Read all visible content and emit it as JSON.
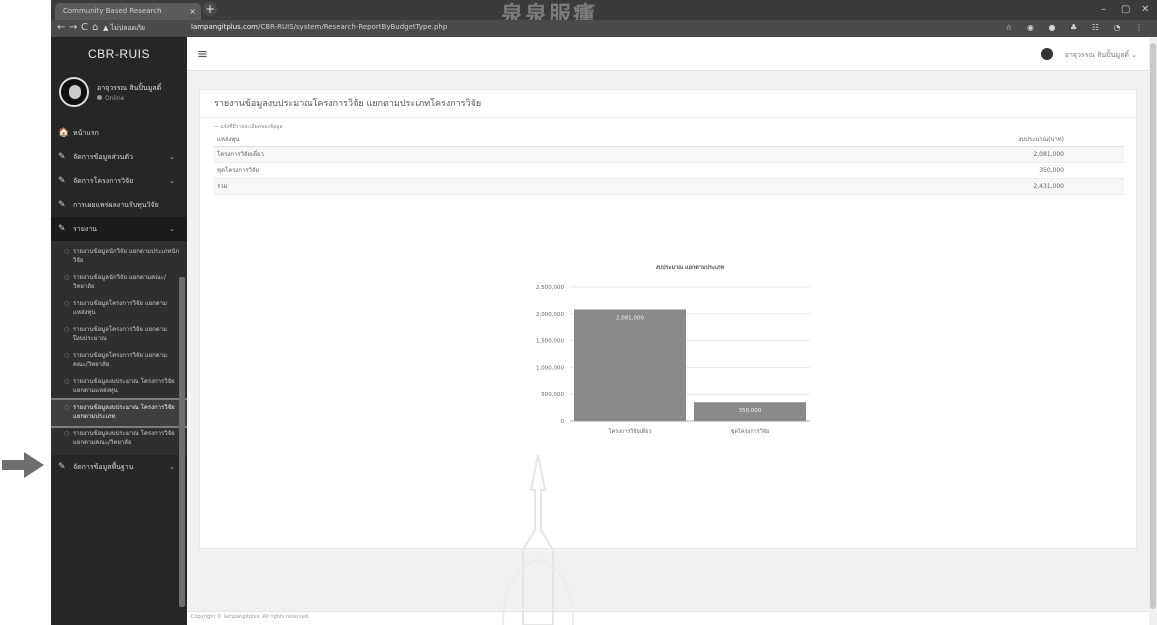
{
  "browser": {
    "tab_title": "Community Based Research",
    "tab_close": "×",
    "new_tab": "+",
    "header_watermark": "泉泉服瘇",
    "window_controls": {
      "minimize": "–",
      "maximize": "▢",
      "close": "✕"
    },
    "nav": {
      "back": "←",
      "forward": "→",
      "reload": "C",
      "home": "⌂"
    },
    "security_label": "▲ ไม่ปลอดภัย",
    "url_host": "lampangitplus.com",
    "url_path": "/CBR-RUIS/system/Research-ReportByBudgetType.php",
    "extension_icons": "☆ ◉ ● ♣ ☷ ◔ ⋮"
  },
  "sidebar": {
    "brand": "CBR-RUIS",
    "user": {
      "name": "อาจุวรรณ สินปิ้นมูลดิ์",
      "status": "Online"
    },
    "menu": [
      {
        "label": "หน้าแรก",
        "icon": "home-icon",
        "glyph": "🏠",
        "chevron": ""
      },
      {
        "label": "จัดการข้อมูลส่วนตัว",
        "icon": "edit-icon",
        "glyph": "✎",
        "chevron": "⌄"
      },
      {
        "label": "จัดการโครงการวิจัย",
        "icon": "edit-icon",
        "glyph": "✎",
        "chevron": "⌄"
      },
      {
        "label": "การเผยแพร่ผลงานรับทุนวิจัย",
        "icon": "edit-icon",
        "glyph": "✎",
        "chevron": ""
      },
      {
        "label": "รายงาน",
        "icon": "edit-icon",
        "glyph": "✎",
        "chevron": "⌄"
      }
    ],
    "report_submenu": [
      "รายงานข้อมูลนักวิจัย แยกตามประเภทนักวิจัย",
      "รายงานข้อมูลนักวิจัย แยกตามคณะ/วิทยาลัย",
      "รายงานข้อมูลโครงการวิจัย แยกตามแหล่งทุน",
      "รายงานข้อมูลโครงการวิจัย แยกตามปีงบประมาณ",
      "รายงานข้อมูลโครงการวิจัย แยกตามคณะ/วิทยาลัย",
      "รายงานข้อมูลงบประมาณ โครงการวิจัย แยกตามแหล่งทุน",
      "รายงานข้อมูลงบประมาณ โครงการวิจัย แยกตามประเภท",
      "รายงานข้อมูลงบประมาณ โครงการวิจัย แยกตามคณะ/วิทยาลัย"
    ],
    "last_menu": {
      "label": "จัดการข้อมูลพื้นฐาน",
      "glyph": "✎",
      "chevron": "⌄"
    },
    "bullet": "○"
  },
  "topbar": {
    "hamburger": "≡",
    "user_name": "อาจุวรรณ สินปิ้นมูลดิ์ ⌄"
  },
  "report": {
    "title": "รายงานข้อมูลงบประมาณโครงการวิจัย แยกตามประเภทโครงการวิจัย",
    "subnote": "— แจ้งที่มีรายละเอียดของข้อมูล",
    "table": {
      "headers": [
        "แหล่งทุน",
        "งบประมาณ(บาท)"
      ],
      "rows": [
        [
          "โครงการวิจัยเดี่ยว",
          "2,081,000"
        ],
        [
          "ชุดโครงการวิจัย",
          "350,000"
        ],
        [
          "รวม",
          "2,431,000"
        ]
      ]
    }
  },
  "chart_data": {
    "type": "bar",
    "title": "งบประมาณ แยกตามประเภท",
    "categories": [
      "โครงการวิจัยเดี่ยว",
      "ชุดโครงการวิจัย"
    ],
    "values": [
      2081000,
      350000
    ],
    "data_labels": [
      "2,081,000",
      "350,000"
    ],
    "yticks": [
      "0",
      "500,000",
      "1,000,000",
      "1,500,000",
      "2,000,000",
      "2,500,000"
    ],
    "ylim": [
      0,
      2500000
    ],
    "grid": true,
    "bar_color": "#8a8a8a",
    "legend": "none"
  },
  "footer": {
    "copyright": "Copyright © lampangitplus. All rights reserved."
  },
  "annotation": {
    "arrow_color": "#6f6f6f"
  }
}
